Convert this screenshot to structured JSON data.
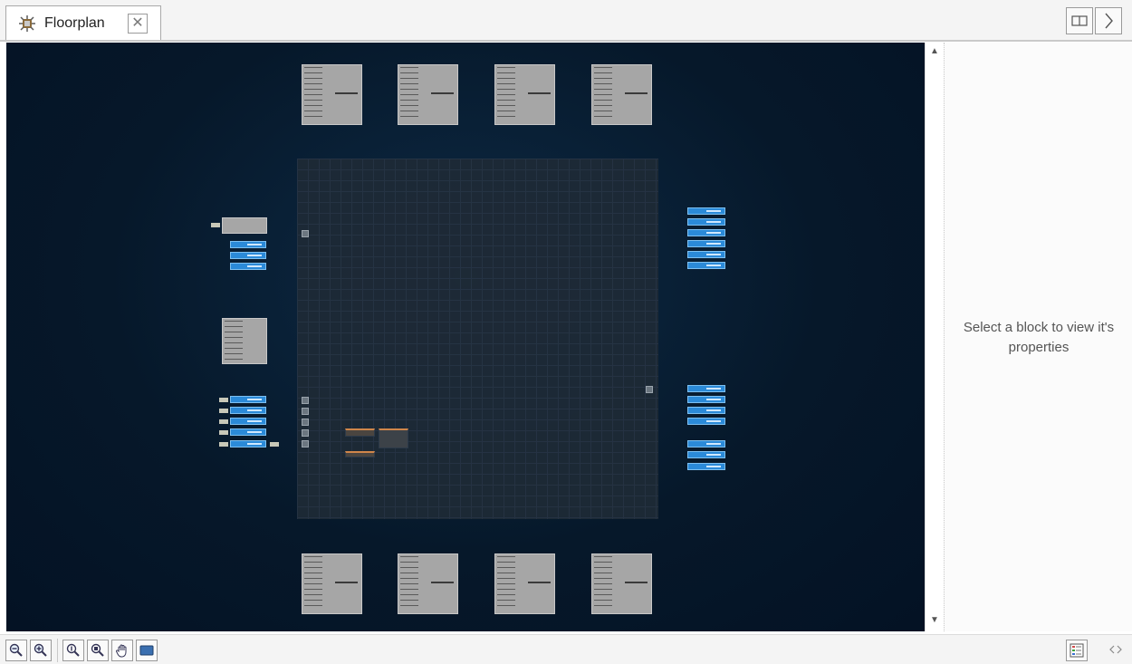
{
  "tabs": [
    {
      "label": "Floorplan",
      "icon": "chip-gear-icon",
      "closable": true
    }
  ],
  "toolbar_right": [
    {
      "name": "split-view-button",
      "icon": "split-view-icon"
    },
    {
      "name": "expand-panel-button",
      "icon": "chevron-right-icon"
    }
  ],
  "properties_panel": {
    "message": "Select a block to view it's properties"
  },
  "bottom_toolbar": [
    {
      "name": "zoom-out-button",
      "icon": "zoom-out-icon"
    },
    {
      "name": "zoom-in-button",
      "icon": "zoom-in-icon"
    },
    {
      "name": "zoom-actual-button",
      "icon": "zoom-actual-icon"
    },
    {
      "name": "zoom-fit-button",
      "icon": "zoom-fit-icon"
    },
    {
      "name": "pan-button",
      "icon": "hand-icon"
    },
    {
      "name": "view-mode-button",
      "icon": "monitor-icon"
    },
    {
      "name": "legend-button",
      "icon": "legend-list-icon"
    },
    {
      "name": "code-view-button",
      "icon": "code-brackets-icon"
    }
  ],
  "colors": {
    "canvas_bg": "#06182a",
    "grid": "#1e2a36",
    "pin_blue": "#2b8ad8",
    "block_gray": "#a6a6a6",
    "accent_orange": "#d0864a"
  }
}
